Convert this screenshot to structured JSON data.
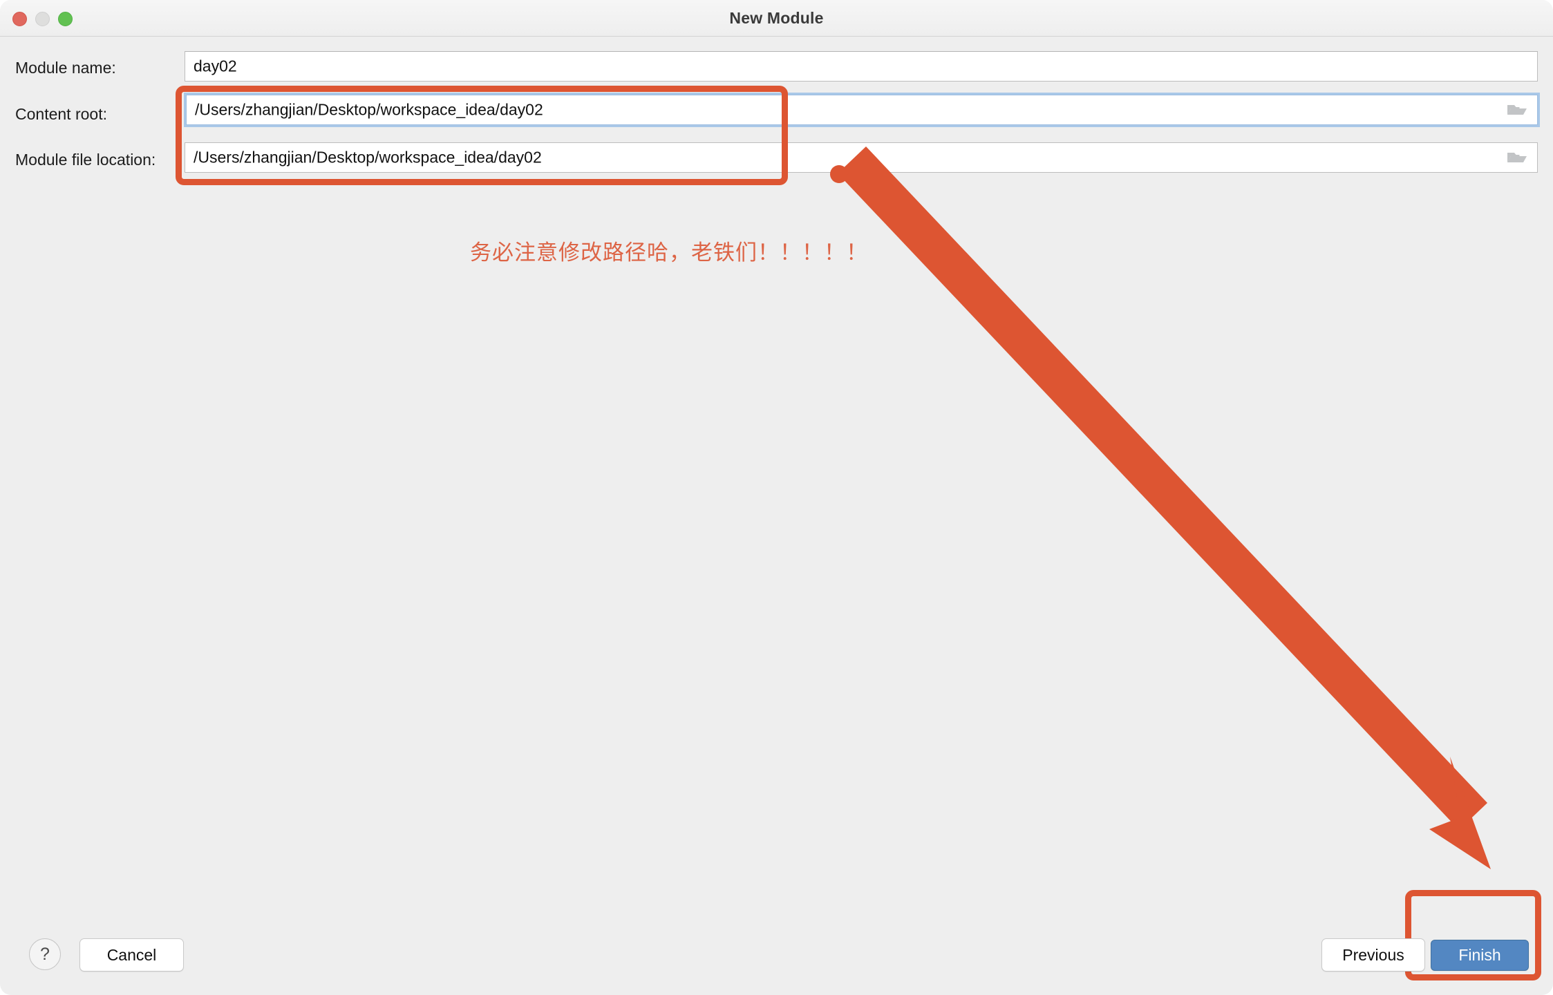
{
  "window": {
    "title": "New Module",
    "traffic_lights": [
      {
        "name": "close-button",
        "color": "#e0685e"
      },
      {
        "name": "minimize-button",
        "color": "#dededd"
      },
      {
        "name": "maximize-button",
        "color": "#62c152"
      }
    ]
  },
  "form": {
    "module_name": {
      "label": "Module name:",
      "value": "day02",
      "placeholder": "Module name"
    },
    "content_root": {
      "label": "Content root:",
      "value": "/Users/zhangjian/Desktop/workspace_idea/day02",
      "placeholder": "Content root path",
      "browse_icon": "folder-icon",
      "focused": true
    },
    "module_file_location": {
      "label": "Module file location:",
      "value": "/Users/zhangjian/Desktop/workspace_idea/day02",
      "placeholder": "Module file location path",
      "browse_icon": "folder-icon",
      "focused": false
    }
  },
  "annotations": {
    "note_text": "务必注意修改路径哈，老铁们！！！！！",
    "highlight_color": "#dd5532",
    "note_color": "#dd6445",
    "boxes": [
      {
        "name": "path-fields-highlight"
      },
      {
        "name": "finish-button-highlight"
      }
    ],
    "arrow": {
      "name": "pointer-arrow",
      "color": "#dd5532"
    }
  },
  "footer": {
    "help_label": "?",
    "cancel_label": "Cancel",
    "previous_label": "Previous",
    "finish_label": "Finish",
    "finish_color": "#5387c2"
  }
}
